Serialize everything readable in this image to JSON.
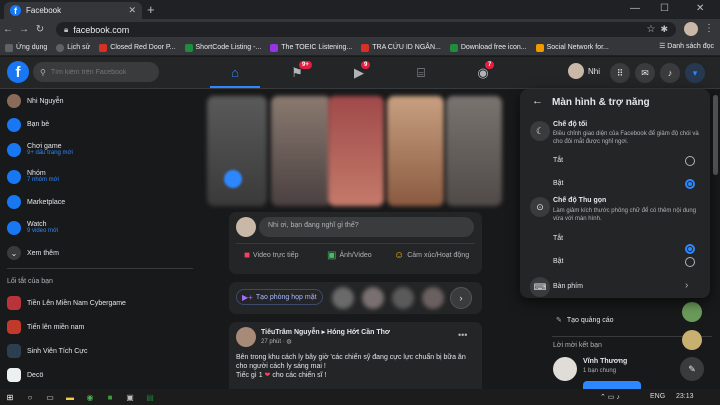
{
  "browser": {
    "tab_title": "Facebook",
    "url": "facebook.com",
    "bookmarks": [
      {
        "label": "Ứng dụng",
        "color": "#5f6368"
      },
      {
        "label": "Lịch sử",
        "color": "#5f6368"
      },
      {
        "label": "Closed Red Door P...",
        "color": "#d93025"
      },
      {
        "label": "ShortCode Listing -...",
        "color": "#1e8e3e"
      },
      {
        "label": "The TOEIC Listening...",
        "color": "#9334e6"
      },
      {
        "label": "TRA CỨU ID NGÂN...",
        "color": "#d93025"
      },
      {
        "label": "Download free icon...",
        "color": "#1e8e3e"
      },
      {
        "label": "Social Network for...",
        "color": "#f29900"
      }
    ],
    "reading_list": "Danh sách đọc"
  },
  "fb_header": {
    "search_placeholder": "Tìm kiếm trên Facebook",
    "badges": {
      "pages": "9+",
      "watch": "9",
      "groups": "7"
    },
    "profile_name": "Nhi"
  },
  "left_sidebar": {
    "items": [
      {
        "label": "Nhi Nguyễn",
        "sub": "",
        "color": "#8a6b5a"
      },
      {
        "label": "Bạn bè",
        "sub": "",
        "color": "#1877f2"
      },
      {
        "label": "Chơi game",
        "sub": "9+ dấu trang mới",
        "color": "#1877f2"
      },
      {
        "label": "Nhóm",
        "sub": "7 nhóm mới",
        "color": "#1877f2"
      },
      {
        "label": "Marketplace",
        "sub": "",
        "color": "#1877f2"
      },
      {
        "label": "Watch",
        "sub": "9 video mới",
        "color": "#1877f2"
      }
    ],
    "see_more": "Xem thêm",
    "shortcuts_title": "Lối tắt của bạn",
    "shortcuts": [
      {
        "label": "Tiền Lên Miền Nam Cybergame",
        "color": "#b8343a"
      },
      {
        "label": "Tiến lên miền nam",
        "color": "#c0392b"
      },
      {
        "label": "Sinh Viên Tích Cực",
        "color": "#2c3e50"
      },
      {
        "label": "Decö",
        "color": "#ecf0f1"
      }
    ]
  },
  "composer": {
    "placeholder": "Nhi ơi, bạn đang nghĩ gì thế?",
    "live": "Video trực tiếp",
    "photo": "Ảnh/Video",
    "feeling": "Cảm xúc/Hoạt động"
  },
  "rooms": {
    "create": "Tạo phòng họp mặt"
  },
  "post": {
    "author": "TiêuTrâm Nguyễn",
    "group": "Hóng Hớt Cần Thơ",
    "time": "27 phút",
    "text1": "Bên trong khu cách ly bây giờ 'các chiến sỹ đang cực lực chuẩn bị bữa ăn cho người cách ly sáng mai !",
    "text2": "Tiếc gì 1",
    "text3": "cho các chiến sĩ !"
  },
  "settings": {
    "title": "Màn hình & trợ năng",
    "dark_title": "Chế độ tối",
    "dark_desc": "Điều chỉnh giao diện của Facebook để giảm độ chói và cho đôi mắt được nghỉ ngơi.",
    "off": "Tắt",
    "on": "Bật",
    "compact_title": "Chế độ Thu gọn",
    "compact_desc": "Làm giảm kích thước phông chữ để có thêm nội dung vừa với màn hình.",
    "compact_on": "Bật",
    "compact_off": "Tắt",
    "keyboard": "Bàn phím",
    "dark_selected": "Bật",
    "compact_selected": "Tắt"
  },
  "right_col": {
    "create_ad": "Tạo quảng cáo",
    "requests_title": "Lời mời kết bạn",
    "friend_name": "Vĩnh Thương",
    "friend_mutual": "1 bạn chung"
  },
  "taskbar": {
    "lang": "ENG",
    "time": "23:13"
  }
}
